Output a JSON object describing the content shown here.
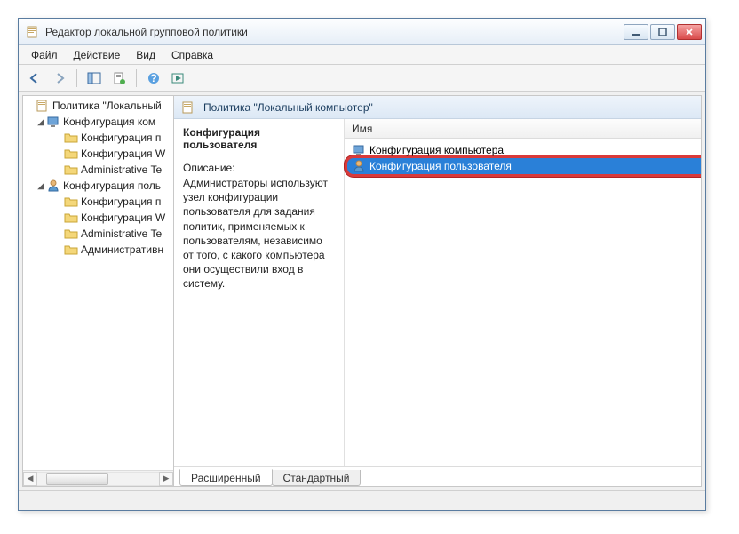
{
  "window": {
    "title": "Редактор локальной групповой политики"
  },
  "menu": {
    "file": "Файл",
    "action": "Действие",
    "view": "Вид",
    "help": "Справка"
  },
  "tree": {
    "root": "Политика \"Локальный",
    "comp": "Конфигурация ком",
    "comp1": "Конфигурация п",
    "comp2": "Конфигурация W",
    "comp3": "Administrative Te",
    "user": "Конфигурация поль",
    "user1": "Конфигурация п",
    "user2": "Конфигурация W",
    "user3": "Administrative Te",
    "user4": "Административн"
  },
  "header": {
    "title": "Политика \"Локальный компьютер\""
  },
  "desc": {
    "selected_title": "Конфигурация пользователя",
    "label": "Описание:",
    "text": "Администраторы используют узел конфигурации пользователя для задания политик, применяемых к пользователям, независимо от того, с какого компьютера они осуществили вход в систему."
  },
  "list": {
    "column": "Имя",
    "items": [
      "Конфигурация компьютера",
      "Конфигурация пользователя"
    ]
  },
  "tabs": {
    "extended": "Расширенный",
    "standard": "Стандартный"
  }
}
